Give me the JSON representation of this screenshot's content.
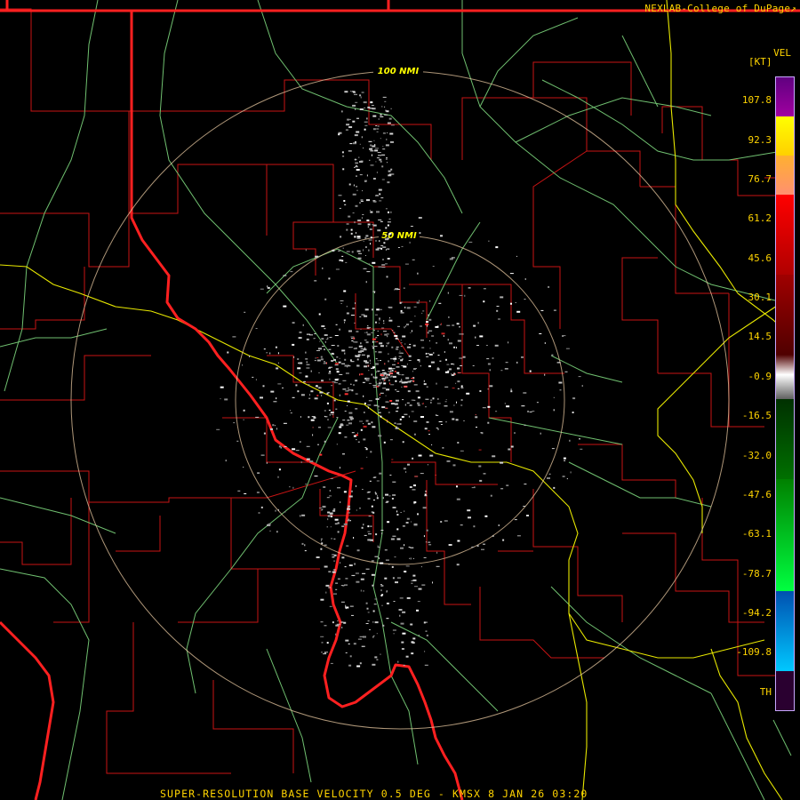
{
  "credit": "NEXLAB-College of DuPage",
  "credit_icon": "external-link-icon",
  "legend": {
    "title": "VEL",
    "units": "[KT]",
    "ticks": [
      "107.8",
      "92.3",
      "76.7",
      "61.2",
      "45.6",
      "30.1",
      "14.5",
      "-0.9",
      "-16.5",
      "-32.0",
      "-47.6",
      "-63.1",
      "-78.7",
      "-94.2",
      "-109.8"
    ],
    "th_label": "TH",
    "colors": [
      "#800080",
      "#ffff00",
      "#ffa060",
      "#ff0000",
      "#b00000",
      "#600000",
      "#bbbbbb",
      "#606060",
      "#006000",
      "#00b000",
      "#00ff40",
      "#0060c0",
      "#00c0ff"
    ]
  },
  "rings": [
    {
      "label": "100 NMI"
    },
    {
      "label": "50 NMI"
    }
  ],
  "product": "SUPER-RESOLUTION BASE VELOCITY 0.5 DEG - KMSX 8 JAN 26 03:20",
  "map_colors": {
    "state_border": "#ff2020",
    "county_border": "#c81414",
    "highway_yellow": "#e8e800",
    "highway_green": "#70c070",
    "ring": "#e8c8a0",
    "ring_label": "#ffff00"
  }
}
